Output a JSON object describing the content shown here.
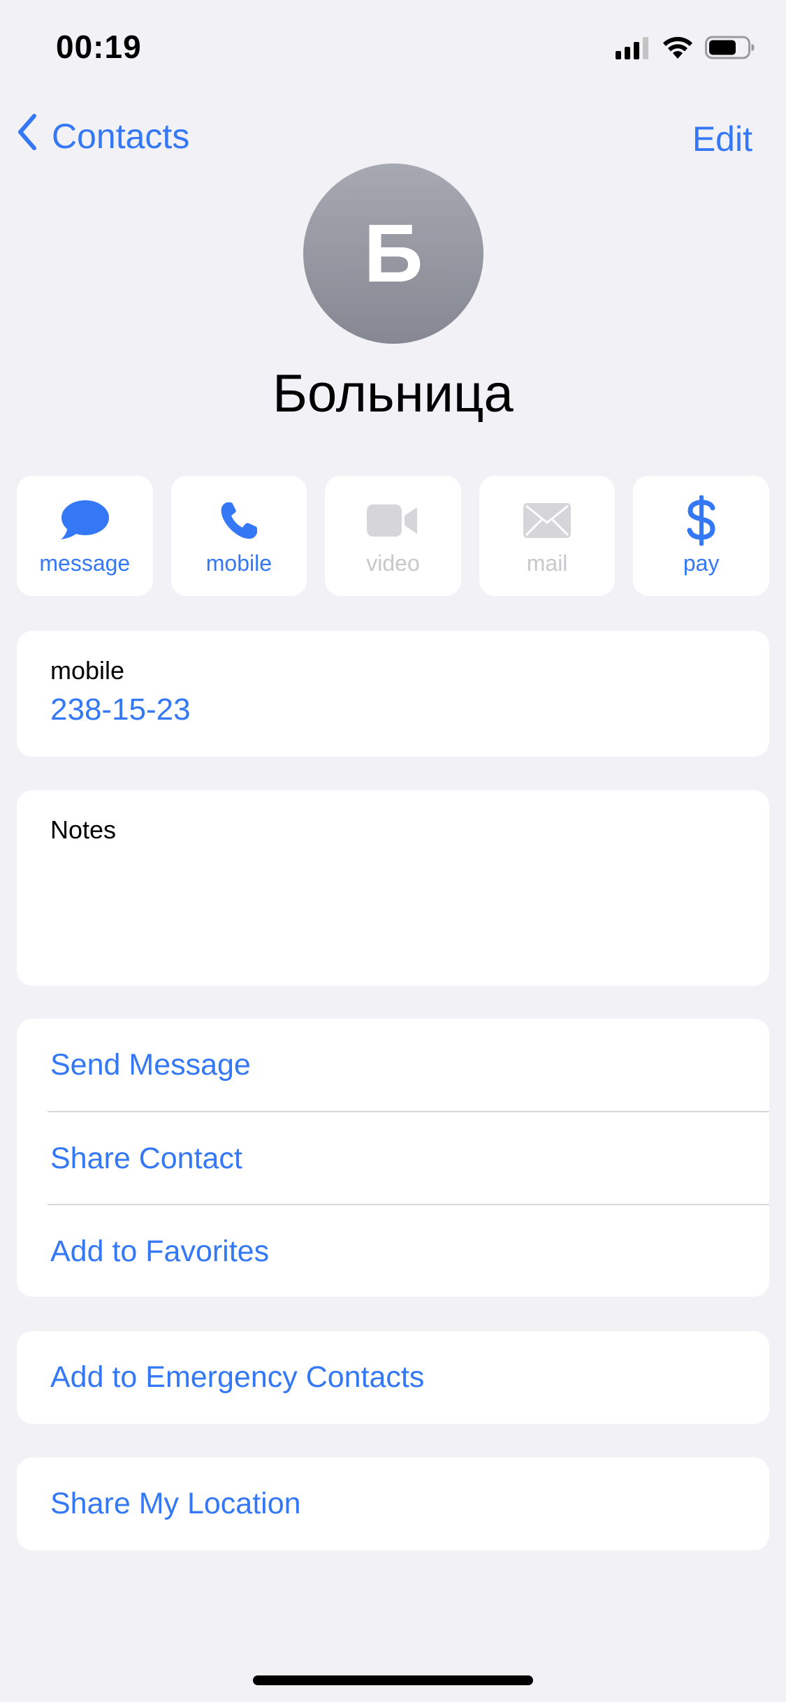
{
  "status_bar": {
    "time": "00:19",
    "icons": [
      "signal-icon",
      "wifi-icon",
      "battery-icon"
    ]
  },
  "nav": {
    "back_label": "Contacts",
    "edit_label": "Edit"
  },
  "contact": {
    "initial": "Б",
    "name": "Больница"
  },
  "actions": [
    {
      "label": "message",
      "icon": "message-bubble-icon",
      "enabled": true
    },
    {
      "label": "mobile",
      "icon": "phone-icon",
      "enabled": true
    },
    {
      "label": "video",
      "icon": "video-camera-icon",
      "enabled": false
    },
    {
      "label": "mail",
      "icon": "envelope-icon",
      "enabled": false
    },
    {
      "label": "pay",
      "icon": "dollar-icon",
      "enabled": true
    }
  ],
  "phone": {
    "label": "mobile",
    "value": "238-15-23"
  },
  "notes": {
    "label": "Notes",
    "value": ""
  },
  "options": [
    {
      "label": "Send Message"
    },
    {
      "label": "Share Contact"
    },
    {
      "label": "Add to Favorites"
    }
  ],
  "emergency": {
    "label": "Add to Emergency Contacts"
  },
  "location": {
    "label": "Share My Location"
  },
  "colors": {
    "accent": "#3478f6",
    "background": "#f1f1f6",
    "disabled": "#c7c7cc",
    "avatar": "#9a9da6"
  }
}
